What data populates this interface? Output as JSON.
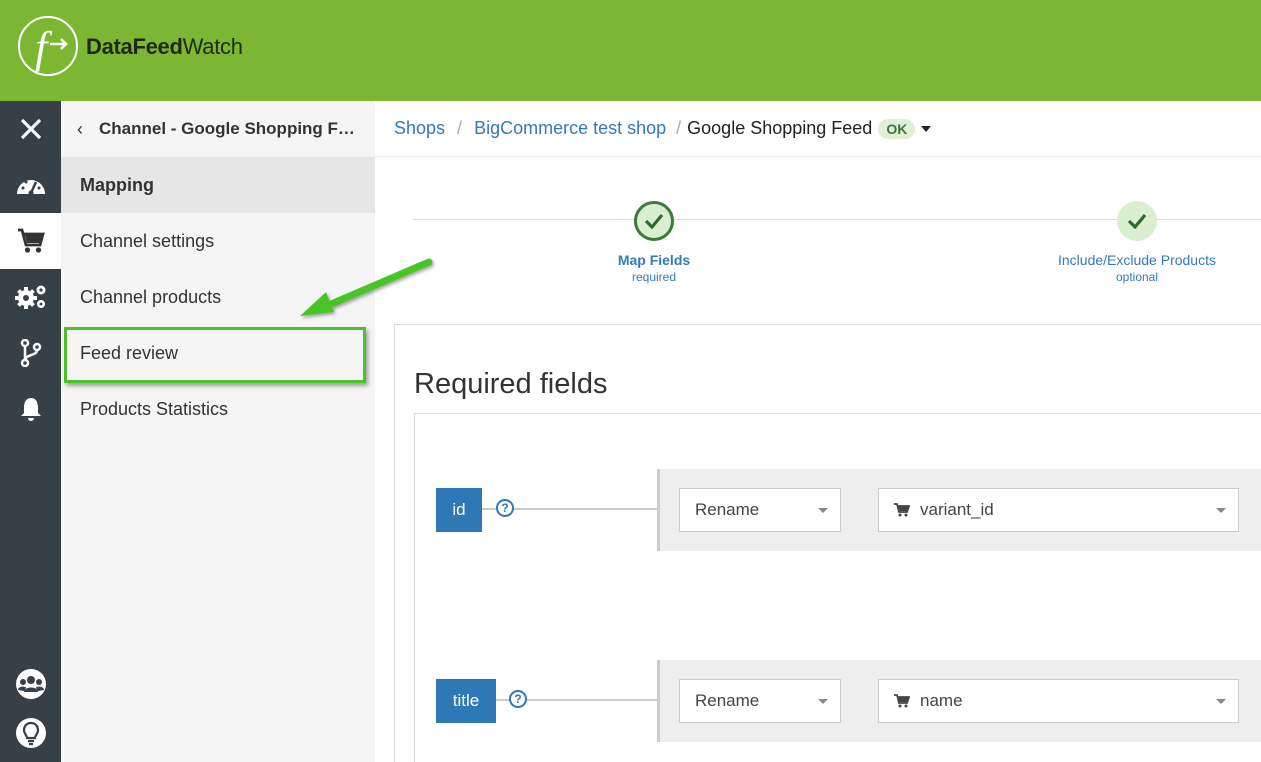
{
  "header": {
    "logo_letter": "f",
    "logo_word_bold": "DataFeed",
    "logo_word_light": "Watch"
  },
  "rail": {
    "items": [
      {
        "icon": "close-icon"
      },
      {
        "icon": "dashboard-icon"
      },
      {
        "icon": "cart-icon",
        "active": true
      },
      {
        "icon": "gears-icon"
      },
      {
        "icon": "branch-icon"
      },
      {
        "icon": "bell-icon"
      },
      {
        "icon": "users-icon"
      },
      {
        "icon": "lightbulb-icon"
      }
    ]
  },
  "subnav": {
    "back_label": "Channel - Google Shopping Feed",
    "items": [
      {
        "label": "Mapping",
        "active": true
      },
      {
        "label": "Channel settings"
      },
      {
        "label": "Channel products"
      },
      {
        "label": "Feed review",
        "highlighted": true
      },
      {
        "label": "Products Statistics"
      }
    ]
  },
  "breadcrumb": {
    "shops": "Shops",
    "shop": "BigCommerce test shop",
    "current": "Google Shopping Feed",
    "status": "OK"
  },
  "stepper": {
    "steps": [
      {
        "title": "Map Fields",
        "sub": "required",
        "state": "active"
      },
      {
        "title": "Include/Exclude Products",
        "sub": "optional",
        "state": "done"
      }
    ]
  },
  "main": {
    "section_title": "Required fields",
    "fields": [
      {
        "name": "id",
        "help": "?",
        "action": "Rename",
        "source": "variant_id"
      },
      {
        "name": "title",
        "help": "?",
        "action": "Rename",
        "source": "name"
      }
    ]
  },
  "colors": {
    "header_green": "#7cb733",
    "rail_dark": "#373f47",
    "accent_blue": "#2e78b6",
    "highlight_green": "#4ac32b"
  }
}
